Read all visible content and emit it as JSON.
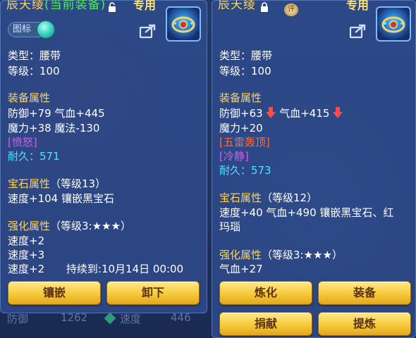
{
  "left": {
    "title_name": "辰天绫",
    "title_status": "(当前装备)",
    "dedicated": "专用",
    "badge_label": "图标",
    "type": "类型：腰带",
    "level": "等级：100",
    "attr_head": "装备属性",
    "attr_line1": "防御+79 气血+445",
    "attr_line2": "魔力+38 魔法-130",
    "special": "[愤怒]",
    "durability_label": "耐久：",
    "durability_value": "571",
    "gem_head": "宝石属性",
    "gem_level": "（等级13）",
    "gem_line": "速度+104 镶嵌黑宝石",
    "enhance_head": "强化属性",
    "enhance_level": "（等级3:★★★）",
    "enh1": "速度+2",
    "enh2": "速度+3",
    "enh3": "速度+2",
    "enh3_until": "持续到:10月14日 00:00",
    "btn_inlay": "镶嵌",
    "btn_unequip": "卸下"
  },
  "right": {
    "title_name": "辰天绫",
    "seal_label": "评",
    "dedicated": "专用",
    "type": "类型：腰带",
    "level": "等级：100",
    "attr_head": "装备属性",
    "attr_line1a": "防御+63",
    "attr_line1b": "气血+415",
    "attr_line2": "魔力+20",
    "special1": "[五雷轰顶]",
    "special2": "[冷静]",
    "durability_label": "耐久：",
    "durability_value": "573",
    "gem_head": "宝石属性",
    "gem_level": "（等级12）",
    "gem_line1": "速度+40 气血+490 镶嵌黑宝石、红",
    "gem_line2": "玛瑙",
    "enhance_head": "强化属性",
    "enhance_level": "（等级3:★★★）",
    "enh1": "气血+27",
    "btn_refine": "炼化",
    "btn_equip": "装备",
    "btn_donate": "捐献",
    "btn_extract": "提炼"
  },
  "under": {
    "label1": "防御",
    "value1": "1262",
    "label2": "速度",
    "value2": "446"
  },
  "colors": {
    "title": "#ffd45a",
    "current": "#49f04d",
    "special_purple": "#d15ee8",
    "special_red": "#ff6a3a",
    "durability": "#5adfff",
    "button": "#f7c93a"
  }
}
